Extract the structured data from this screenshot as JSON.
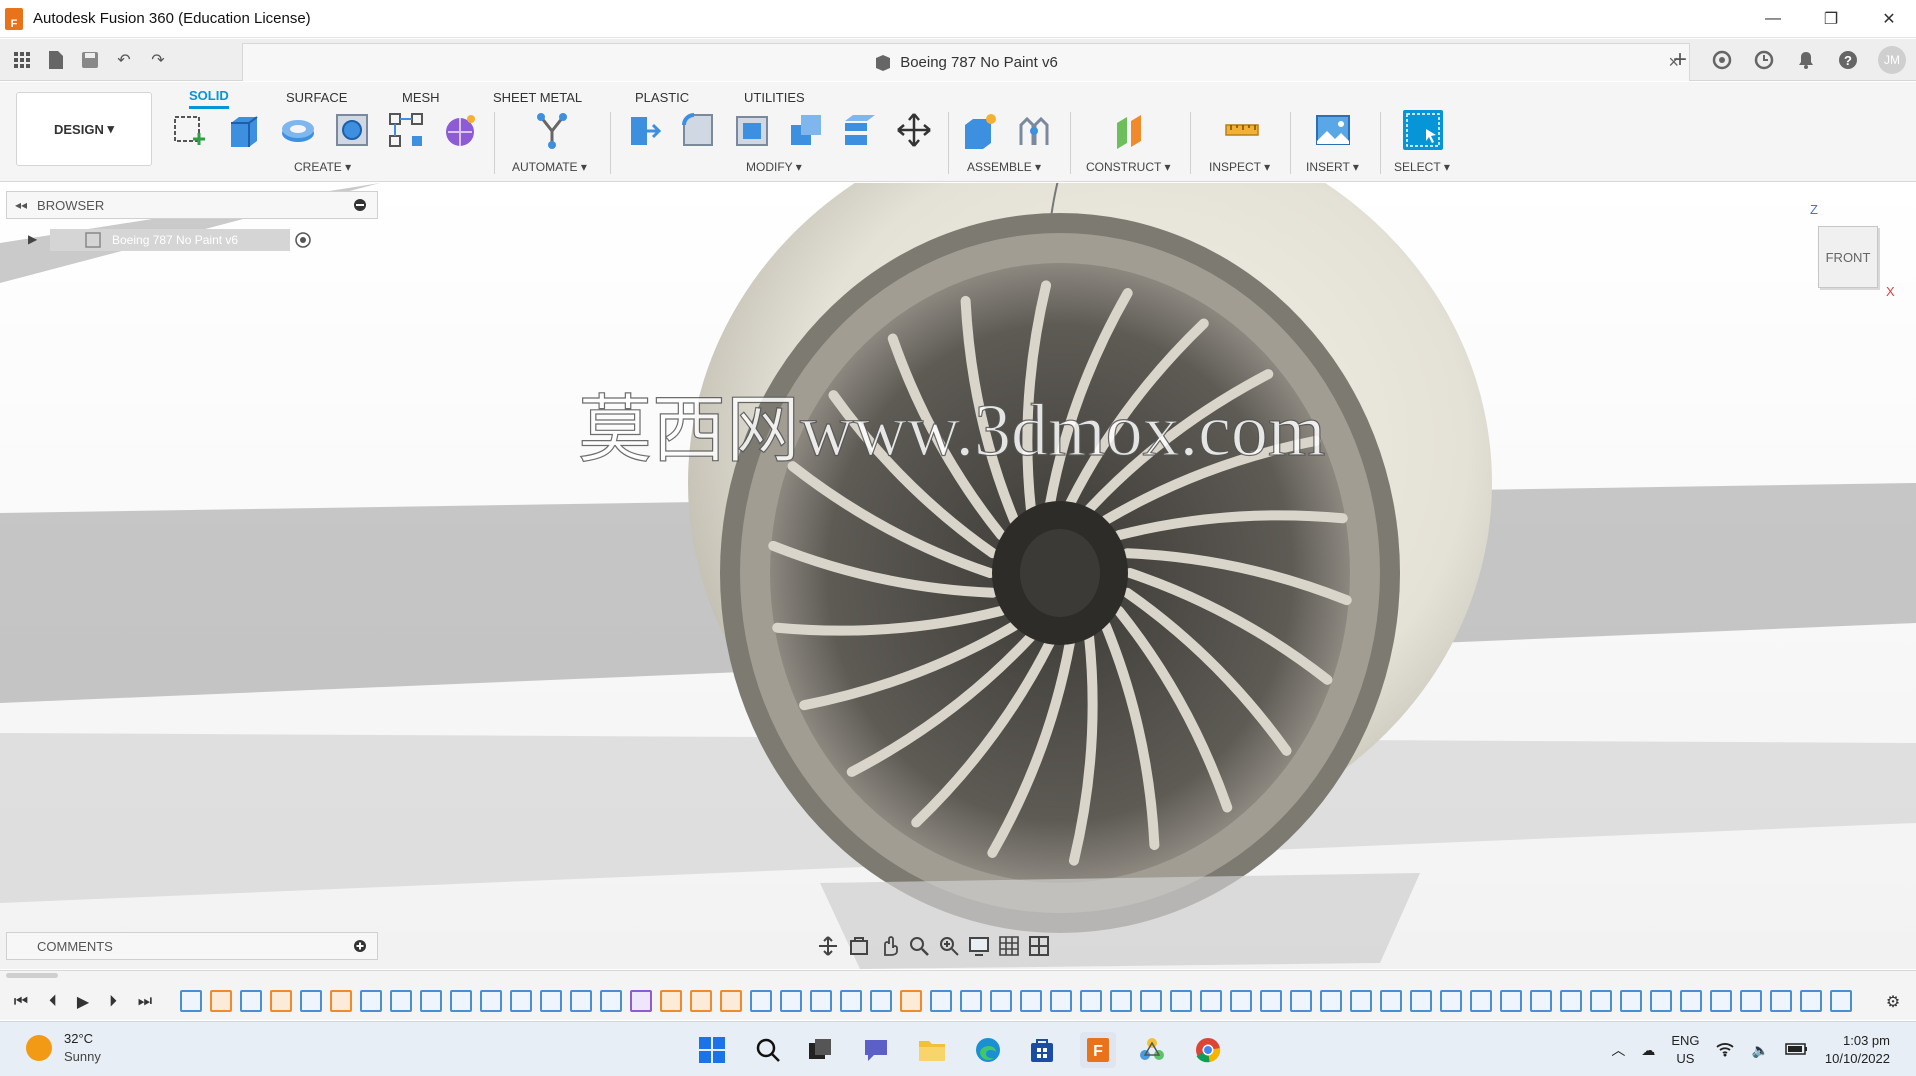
{
  "window": {
    "title": "Autodesk Fusion 360 (Education License)",
    "logo_letter": "F",
    "controls": [
      "minimize-icon",
      "restore-icon",
      "close-icon"
    ]
  },
  "tabbar": {
    "document_title": "Boeing 787 No Paint v6",
    "close_glyph": "×",
    "user_initials": "JM",
    "icons": [
      "app-grid-icon",
      "file-icon",
      "save-icon",
      "undo-icon",
      "redo-icon",
      "new-tab-plus-icon",
      "extensions-icon",
      "job-status-icon",
      "notifications-bell-icon",
      "help-icon"
    ]
  },
  "toolbar": {
    "workspace_label": "DESIGN",
    "tabs": [
      "SOLID",
      "SURFACE",
      "MESH",
      "SHEET METAL",
      "PLASTIC",
      "UTILITIES"
    ],
    "active_tab": "SOLID",
    "groups": {
      "create": "CREATE",
      "automate": "AUTOMATE",
      "modify": "MODIFY",
      "assemble": "ASSEMBLE",
      "construct": "CONSTRUCT",
      "inspect": "INSPECT",
      "insert": "INSERT",
      "select": "SELECT"
    },
    "dropdown_glyph": "▾",
    "colors": {
      "accent": "#0696d7",
      "solid_blue": "#3d8fe0",
      "orange": "#f08a2a",
      "purple": "#8e5bd6"
    }
  },
  "browser": {
    "title": "BROWSER",
    "root_node": "Boeing 787 No Paint v6"
  },
  "viewport": {
    "viewcube_face": "FRONT",
    "axis_z": "Z",
    "axis_x": "X",
    "watermark": "莫西网www.3dmox.com",
    "nav_icons": [
      "orbit-icon",
      "look-at-icon",
      "pan-icon",
      "zoom-icon",
      "zoom-window-icon",
      "display-settings-icon",
      "grid-settings-icon",
      "viewports-icon"
    ]
  },
  "comments": {
    "title": "COMMENTS"
  },
  "timeline": {
    "controls": [
      "first-icon",
      "previous-icon",
      "play-icon",
      "next-icon",
      "last-icon"
    ],
    "settings_icon": "gear-icon"
  },
  "taskbar": {
    "temperature": "32°C",
    "weather": "Sunny",
    "apps": [
      "windows-start-icon",
      "search-icon",
      "task-view-icon",
      "teams-chat-icon",
      "file-explorer-icon",
      "edge-icon",
      "store-icon",
      "fusion360-icon",
      "network-app-icon",
      "chrome-icon"
    ],
    "language": "ENG",
    "region": "US",
    "time": "1:03 pm",
    "date": "10/10/2022"
  }
}
